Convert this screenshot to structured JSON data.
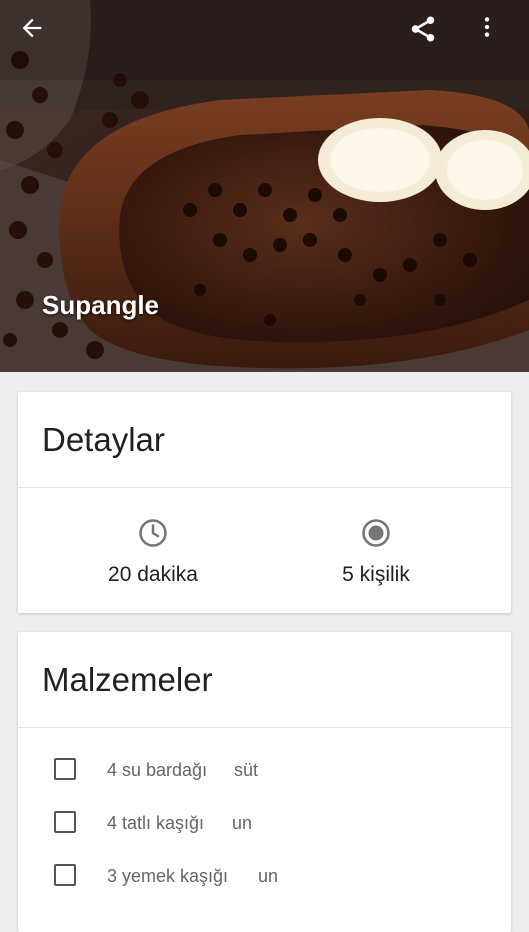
{
  "recipe": {
    "title": "Supangle"
  },
  "toolbar": {
    "back_icon": "arrow-back-icon",
    "share_icon": "share-icon",
    "more_icon": "more-vert-icon"
  },
  "details": {
    "title": "Detaylar",
    "time": {
      "icon": "clock-icon",
      "text": "20 dakika"
    },
    "servings": {
      "icon": "radio-icon",
      "text": "5 kişilik"
    }
  },
  "ingredients": {
    "title": "Malzemeler",
    "items": [
      {
        "amount": "4 su bardağı",
        "name": "süt"
      },
      {
        "amount": "4 tatlı kaşığı",
        "name": "un"
      },
      {
        "amount": "3 yemek kaşığı",
        "name": "un"
      }
    ]
  },
  "colors": {
    "text_primary": "#212121",
    "text_secondary": "#666666",
    "background": "#eeeeee"
  }
}
